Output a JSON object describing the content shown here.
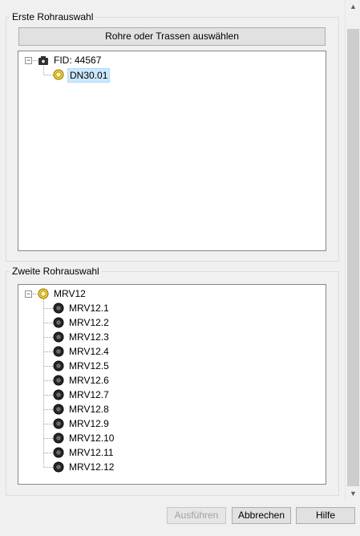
{
  "first_group": {
    "title": "Erste Rohrauswahl",
    "select_button": "Rohre oder Trassen auswählen",
    "tree": {
      "root": {
        "label": "FID: 44567",
        "expander": "−",
        "icon": "camera-icon"
      },
      "children": [
        {
          "label": "DN30.01",
          "icon": "yellow-pipe-icon",
          "selected": true
        }
      ]
    }
  },
  "second_group": {
    "title": "Zweite Rohrauswahl",
    "tree": {
      "root": {
        "label": "MRV12",
        "expander": "−",
        "icon": "yellow-pipe-icon"
      },
      "children": [
        {
          "label": "MRV12.1",
          "icon": "black-pipe-icon"
        },
        {
          "label": "MRV12.2",
          "icon": "black-pipe-icon"
        },
        {
          "label": "MRV12.3",
          "icon": "black-pipe-icon"
        },
        {
          "label": "MRV12.4",
          "icon": "black-pipe-icon"
        },
        {
          "label": "MRV12.5",
          "icon": "black-pipe-icon"
        },
        {
          "label": "MRV12.6",
          "icon": "black-pipe-icon"
        },
        {
          "label": "MRV12.7",
          "icon": "black-pipe-icon"
        },
        {
          "label": "MRV12.8",
          "icon": "black-pipe-icon"
        },
        {
          "label": "MRV12.9",
          "icon": "black-pipe-icon"
        },
        {
          "label": "MRV12.10",
          "icon": "black-pipe-icon"
        },
        {
          "label": "MRV12.11",
          "icon": "black-pipe-icon"
        },
        {
          "label": "MRV12.12",
          "icon": "black-pipe-icon"
        }
      ]
    }
  },
  "footer": {
    "run_label": "Ausführen",
    "cancel_label": "Abbrechen",
    "help_label": "Hilfe"
  },
  "colors": {
    "selection": "#cce8ff",
    "yellow_icon": "#f5d63a",
    "black_icon": "#2b2b2b"
  }
}
